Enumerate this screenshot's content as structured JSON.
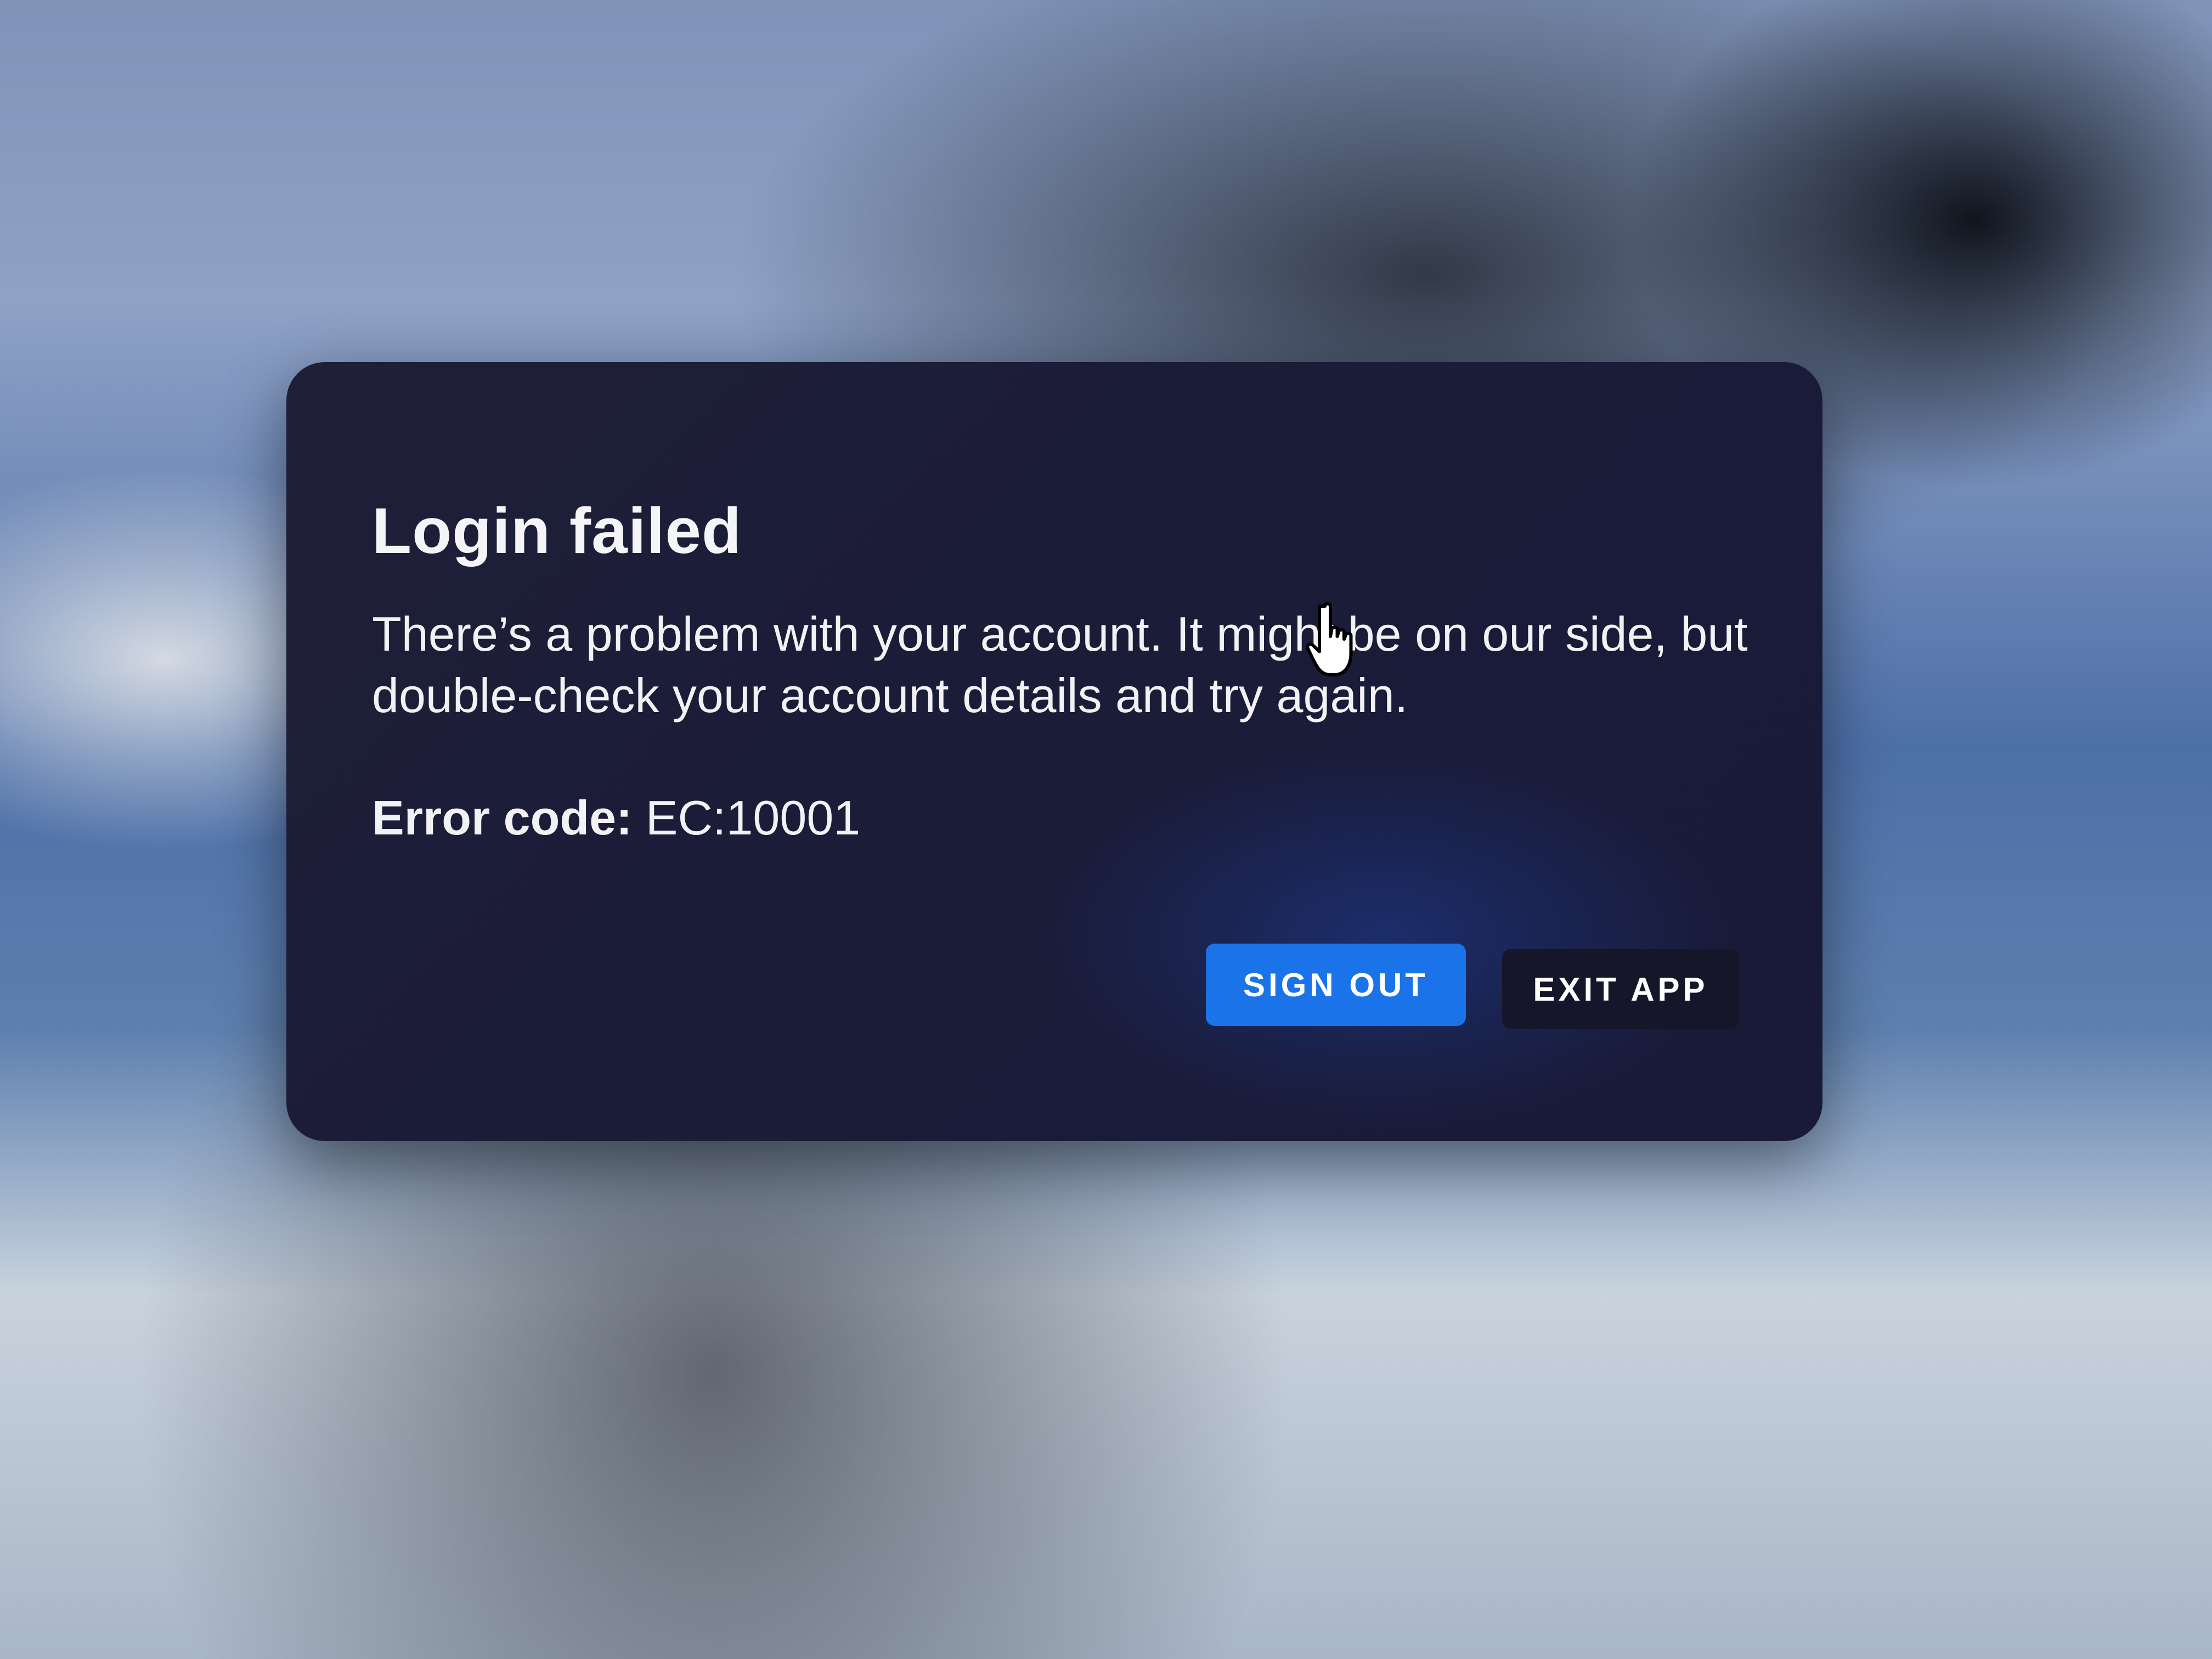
{
  "dialog": {
    "title": "Login failed",
    "message": "There’s a problem with your account. It might be on our side, but double-check your account details and try again.",
    "error_label": "Error code:",
    "error_code": "EC:10001",
    "buttons": {
      "sign_out": "SIGN OUT",
      "exit_app": "EXIT APP"
    }
  },
  "colors": {
    "dialog_bg": "#1b1c38",
    "primary_button": "#1a73e8",
    "secondary_button": "#15162a",
    "text": "#ffffff"
  },
  "icons": {
    "cursor": "hand-pointer-icon"
  }
}
